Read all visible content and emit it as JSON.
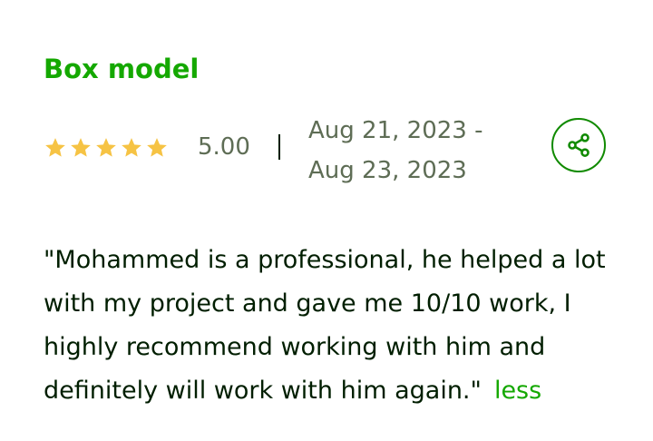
{
  "review_card": {
    "title": "Box model",
    "rating": {
      "stars": 5,
      "max_stars": 5,
      "value_text": "5.00",
      "star_color": "#f6c344"
    },
    "date_range": "Aug 21, 2023 - Aug 23, 2023",
    "share_icon": "share-icon",
    "review_text": "\"Mohammed is a professional, he helped a lot with my project and gave me 10/10 work, I highly recommend working with him and definitely will work with him again.\"",
    "toggle_label": "less"
  },
  "colors": {
    "accent": "#14a800",
    "text": "#001e00",
    "muted": "#5e6d55"
  }
}
